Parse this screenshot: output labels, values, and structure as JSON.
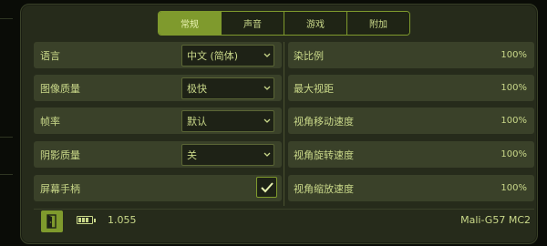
{
  "tabs": [
    {
      "label": "常规",
      "active": true
    },
    {
      "label": "声音",
      "active": false
    },
    {
      "label": "游戏",
      "active": false
    },
    {
      "label": "附加",
      "active": false
    }
  ],
  "left_settings": [
    {
      "label": "语言",
      "value": "中文 (简体)"
    },
    {
      "label": "图像质量",
      "value": "极快"
    },
    {
      "label": "帧率",
      "value": "默认"
    },
    {
      "label": "阴影质量",
      "value": "关"
    },
    {
      "label": "屏幕手柄",
      "checked": true
    }
  ],
  "right_settings": [
    {
      "label": "染比例",
      "value": "100%"
    },
    {
      "label": "最大视距",
      "value": "100%"
    },
    {
      "label": "视角移动速度",
      "value": "100%"
    },
    {
      "label": "视角旋转速度",
      "value": "100%"
    },
    {
      "label": "视角缩放速度",
      "value": "100%"
    }
  ],
  "footer": {
    "version": "1.055",
    "gpu": "Mali-G57 MC2",
    "battery_bars": 3
  },
  "colors": {
    "accent": "#7f9a2d",
    "text": "#c9d889",
    "row_bg": "#3a4129",
    "panel_bg": "#262b1b"
  },
  "icons": {
    "dropdown": "chevron-down-icon",
    "check": "checkmark-icon",
    "exit": "exit-door-icon",
    "battery": "battery-icon"
  }
}
